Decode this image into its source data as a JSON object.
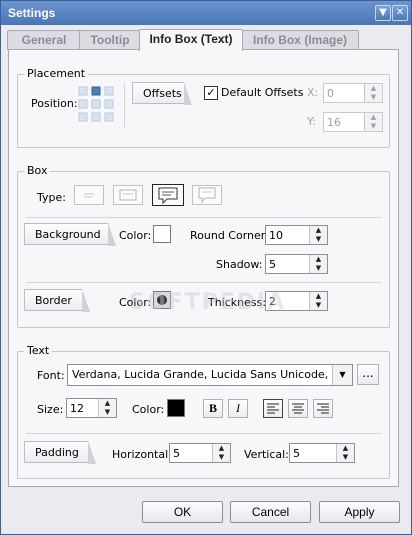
{
  "window": {
    "title": "Settings"
  },
  "tabs": [
    "General",
    "Tooltip",
    "Info Box (Text)",
    "Info Box (Image)"
  ],
  "placement": {
    "legend": "Placement",
    "position_label": "Position:",
    "offsets_label": "Offsets",
    "default_offsets_label": "Default Offsets",
    "default_offsets_checked": true,
    "x_label": "X:",
    "x_value": "0",
    "y_label": "Y:",
    "y_value": "16"
  },
  "box": {
    "legend": "Box",
    "type_label": "Type:",
    "background_label": "Background",
    "color_label": "Color:",
    "background_color": "#ffffff",
    "round_corner_label": "Round Corner:",
    "round_corner_value": "10",
    "shadow_label": "Shadow:",
    "shadow_value": "5",
    "border_label": "Border",
    "border_color_label": "Color:",
    "border_color": "#333333",
    "thickness_label": "Thickness:",
    "thickness_value": "2"
  },
  "text": {
    "legend": "Text",
    "font_label": "Font:",
    "font_value": "Verdana, Lucida Grande, Lucida Sans Unicode, Luci",
    "more_label": "...",
    "size_label": "Size:",
    "size_value": "12",
    "color_label": "Color:",
    "text_color": "#000000",
    "bold_label": "B",
    "italic_label": "I",
    "padding_label": "Padding",
    "horizontal_label": "Horizontal:",
    "horizontal_value": "5",
    "vertical_label": "Vertical:",
    "vertical_value": "5"
  },
  "buttons": {
    "ok": "OK",
    "cancel": "Cancel",
    "apply": "Apply"
  },
  "watermark": "SOFTPEDIA"
}
